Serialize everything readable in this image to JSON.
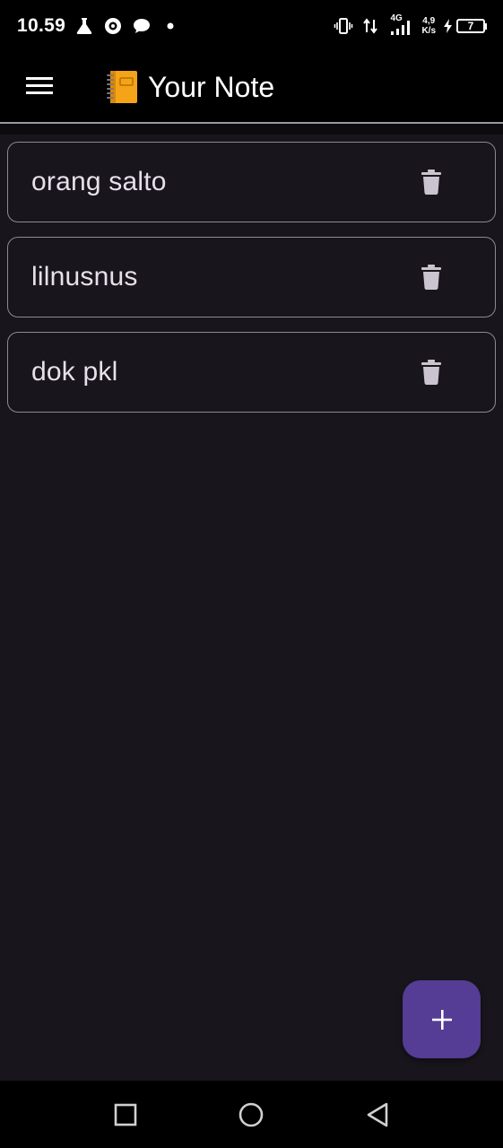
{
  "status_bar": {
    "time": "10.59",
    "network_type": "4G",
    "speed_value": "4,9",
    "speed_unit": "K/s",
    "battery_level": "7",
    "icons": [
      "flask-icon",
      "ring-app-icon",
      "chat-bubble-icon",
      "dot-icon",
      "vibrate-icon",
      "data-arrows-icon",
      "signal-icon",
      "charging-icon"
    ]
  },
  "app_bar": {
    "title": "Your Note",
    "menu_icon": "hamburger-menu-icon",
    "logo_icon": "notebook-emoji-icon",
    "background": "#000000"
  },
  "notes": [
    {
      "title": "orang salto",
      "action_icon": "trash-icon"
    },
    {
      "title": "lilnusnus",
      "action_icon": "trash-icon"
    },
    {
      "title": "dok pkl",
      "action_icon": "trash-icon"
    }
  ],
  "fab": {
    "icon": "plus-icon",
    "color": "#553c94"
  },
  "nav_bar": {
    "buttons": [
      "recents-square-icon",
      "home-circle-icon",
      "back-triangle-icon"
    ]
  },
  "colors": {
    "background": "#18151c",
    "card_border": "#8c8a92",
    "text": "#e6e0ea",
    "icon": "#cac4d0"
  }
}
